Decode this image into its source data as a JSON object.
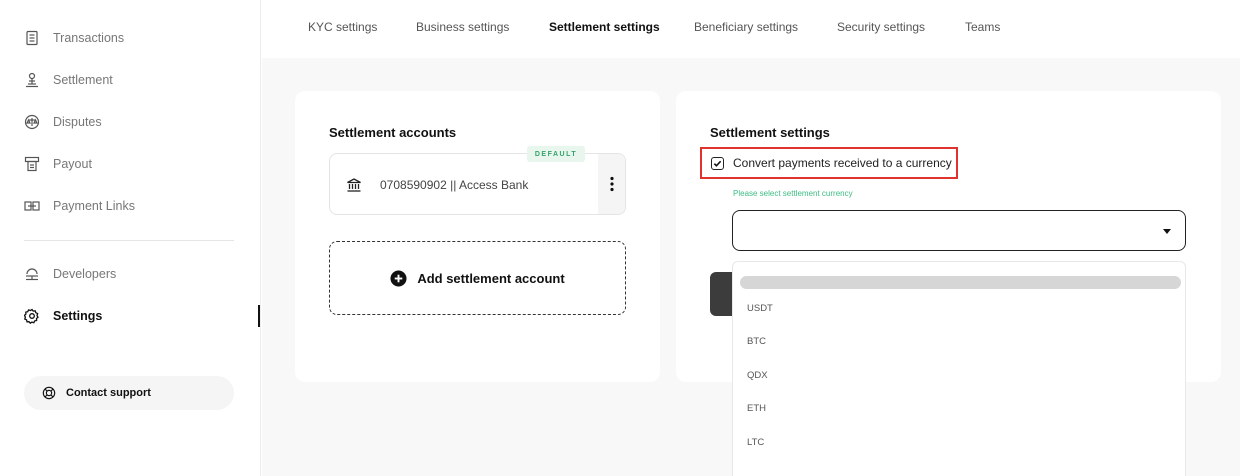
{
  "sidebar": {
    "items": [
      {
        "label": "Transactions",
        "icon": "receipt-icon"
      },
      {
        "label": "Settlement",
        "icon": "user-stand-icon"
      },
      {
        "label": "Disputes",
        "icon": "scale-icon"
      },
      {
        "label": "Payout",
        "icon": "payout-icon"
      },
      {
        "label": "Payment Links",
        "icon": "link-icon"
      },
      {
        "label": "Developers",
        "icon": "developers-icon"
      },
      {
        "label": "Settings",
        "icon": "gear-icon"
      }
    ],
    "contact_support": "Contact support"
  },
  "tabs": [
    "KYC settings",
    "Business settings",
    "Settlement settings",
    "Beneficiary settings",
    "Security settings",
    "Teams"
  ],
  "active_tab": "Settlement settings",
  "settlement_accounts": {
    "title": "Settlement accounts",
    "default_badge": "DEFAULT",
    "account": "0708590902 || Access Bank",
    "add_label": "Add settlement account"
  },
  "settlement_settings": {
    "title": "Settlement settings",
    "convert_label": "Convert payments received to a currency",
    "convert_checked": true,
    "hint": "Please select settlement currency",
    "selected_value": "",
    "options": [
      "USDT",
      "BTC",
      "QDX",
      "ETH",
      "LTC"
    ]
  },
  "colors": {
    "highlight_border": "#e0332d",
    "hint_green": "#3dbd83",
    "badge_green": "#35a36a"
  }
}
